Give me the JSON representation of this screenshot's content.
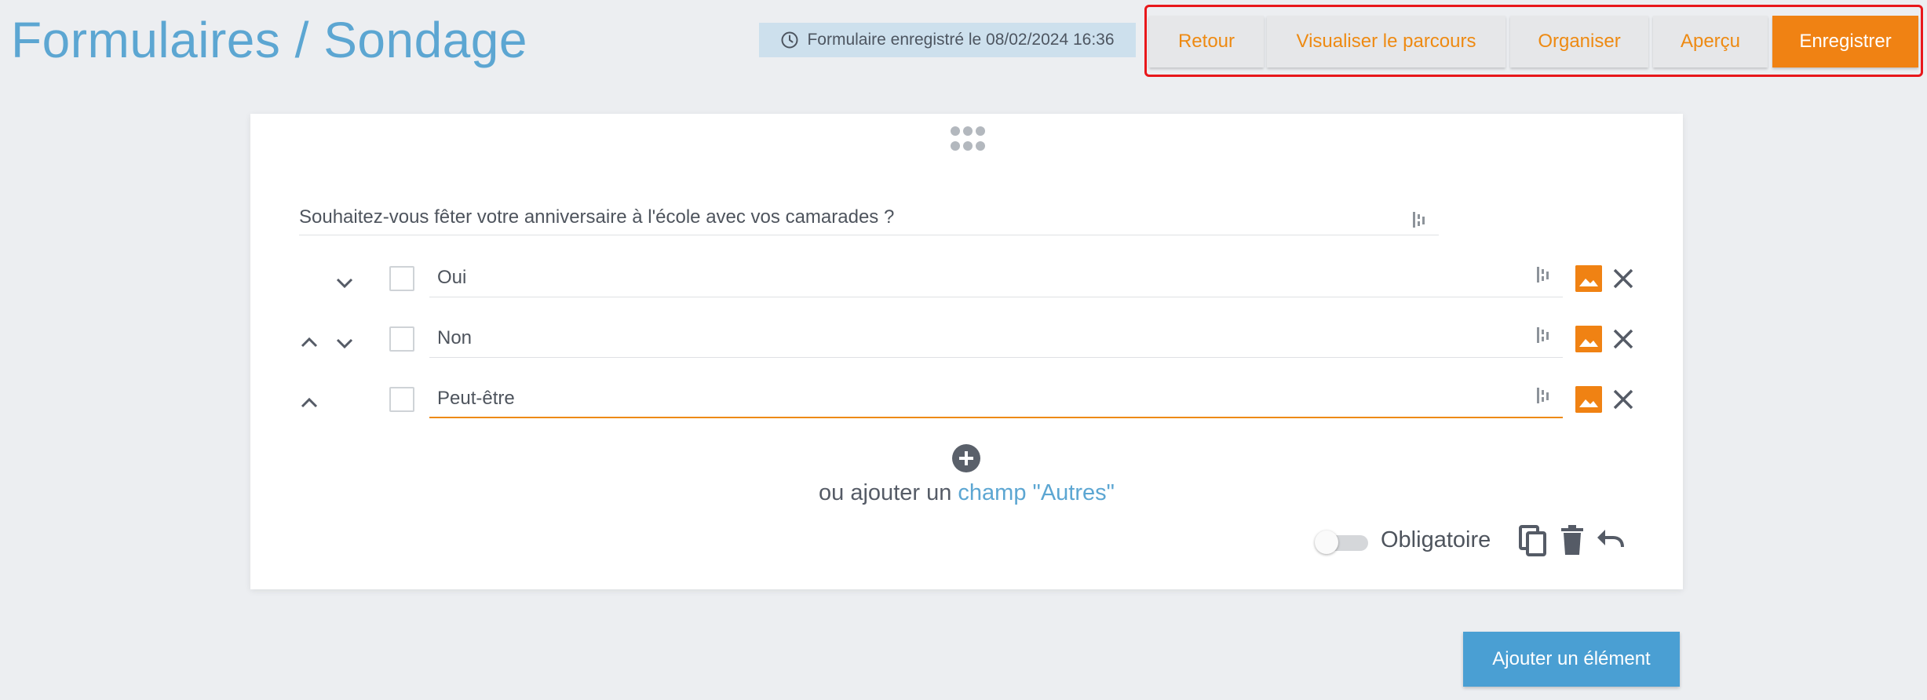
{
  "header": {
    "title": "Formulaires / Sondage",
    "saved_status": "Formulaire enregistré le 08/02/2024 16:36"
  },
  "toolbar": {
    "back_label": "Retour",
    "path_label": "Visualiser le parcours",
    "organize_label": "Organiser",
    "preview_label": "Aperçu",
    "save_label": "Enregistrer"
  },
  "question": {
    "text": "Souhaitez-vous fêter votre anniversaire à l'école avec vos camarades ?",
    "options": [
      {
        "label": "Oui"
      },
      {
        "label": "Non"
      },
      {
        "label": "Peut-être"
      }
    ],
    "add_other_prefix": "ou ajouter un",
    "add_other_link": "champ \"Autres\"",
    "required_label": "Obligatoire"
  },
  "footer": {
    "add_element_label": "Ajouter un élément"
  },
  "colors": {
    "accent_orange": "#f08213",
    "title_blue": "#5ca6d2",
    "highlight_red": "#e8171b",
    "primary_blue": "#4a9fd3"
  },
  "icons": [
    "clock-icon",
    "drag-handle-icon",
    "text-format-icon",
    "chevron-up-icon",
    "chevron-down-icon",
    "image-icon",
    "close-icon",
    "add-circle-icon",
    "copy-icon",
    "trash-icon",
    "undo-icon"
  ]
}
